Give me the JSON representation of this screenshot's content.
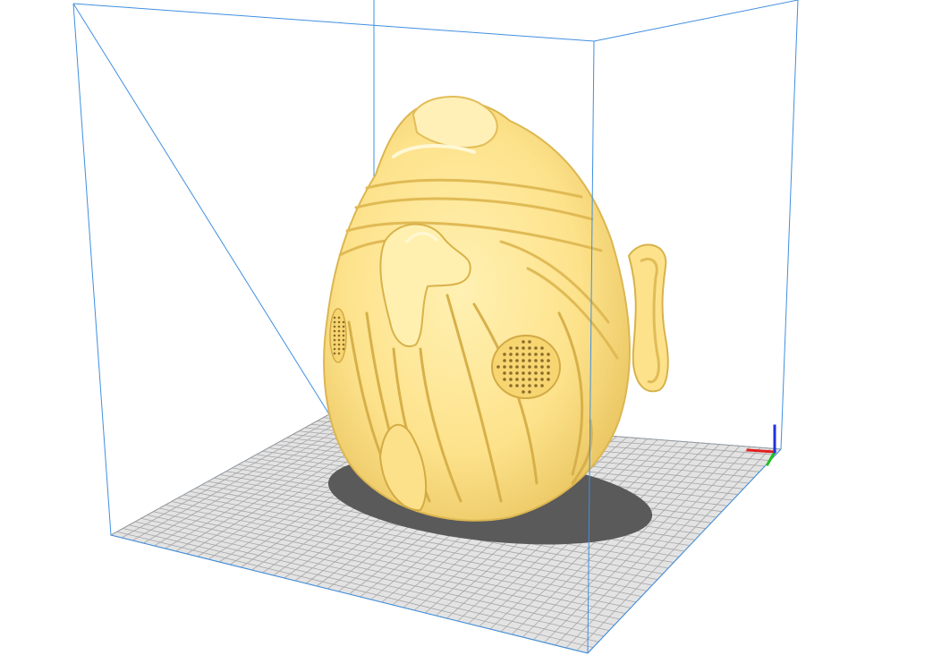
{
  "viewport": {
    "background": "#ffffff"
  },
  "colors": {
    "build_volume_edge": "#3f8fe0",
    "build_plate": "#e3e3e3",
    "build_plate_grid": "#a6a6a6",
    "model": "#fde28b",
    "model_shade": "#e3bf55",
    "model_highlight": "#fff6cc",
    "shadow": "#5a5a5a",
    "axis_x": "#e02020",
    "axis_y": "#20c020",
    "axis_z": "#2030e0"
  },
  "icons": {
    "origin_axis": "xyz-axis-gizmo-icon"
  }
}
